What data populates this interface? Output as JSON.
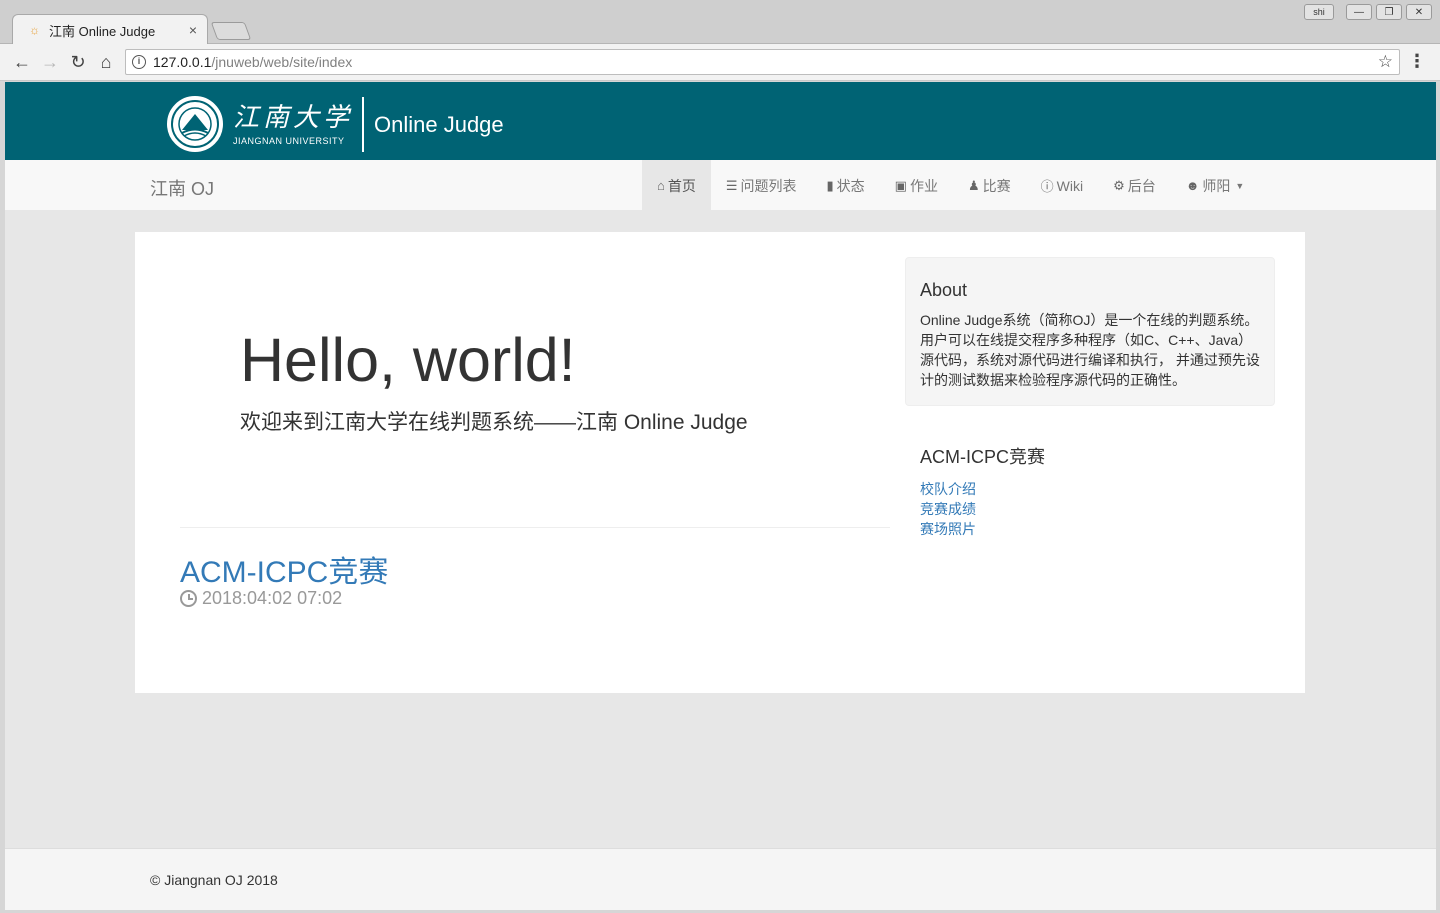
{
  "browser": {
    "tab_title": "江南 Online Judge",
    "tab_close": "×",
    "window_user": "shi",
    "url_host": "127.0.0.1",
    "url_path": "/jnuweb/web/site/index"
  },
  "header": {
    "logo_cn": "江南大学",
    "logo_en": "JIANGNAN UNIVERSITY",
    "site_title": "Online Judge"
  },
  "navbar": {
    "brand": "江南 OJ",
    "items": [
      {
        "label": "首页",
        "icon": "home-icon",
        "active": true
      },
      {
        "label": "问题列表",
        "icon": "list-icon"
      },
      {
        "label": "状态",
        "icon": "signal-icon"
      },
      {
        "label": "作业",
        "icon": "book-icon"
      },
      {
        "label": "比赛",
        "icon": "trophy-icon"
      },
      {
        "label": "Wiki",
        "icon": "info-icon"
      },
      {
        "label": "后台",
        "icon": "gear-icon"
      },
      {
        "label": "师阳",
        "icon": "user-icon",
        "dropdown": true
      }
    ]
  },
  "main": {
    "hero_title": "Hello, world!",
    "hero_subtitle": "欢迎来到江南大学在线判题系统——江南 Online Judge",
    "post_title": "ACM-ICPC竞赛",
    "post_date": "2018:04:02 07:02"
  },
  "sidebar": {
    "about_title": "About",
    "about_text": "Online Judge系统（简称OJ）是一个在线的判题系统。用户可以在线提交程序多种程序（如C、C++、Java）源代码，系统对源代码进行编译和执行， 并通过预先设计的测试数据来检验程序源代码的正确性。",
    "section_title": "ACM-ICPC竞赛",
    "links": [
      "校队介绍",
      "竞赛成绩",
      "赛场照片"
    ]
  },
  "footer": {
    "text": "© Jiangnan OJ 2018"
  },
  "colors": {
    "header_bg": "#006374",
    "link": "#337ab7"
  }
}
